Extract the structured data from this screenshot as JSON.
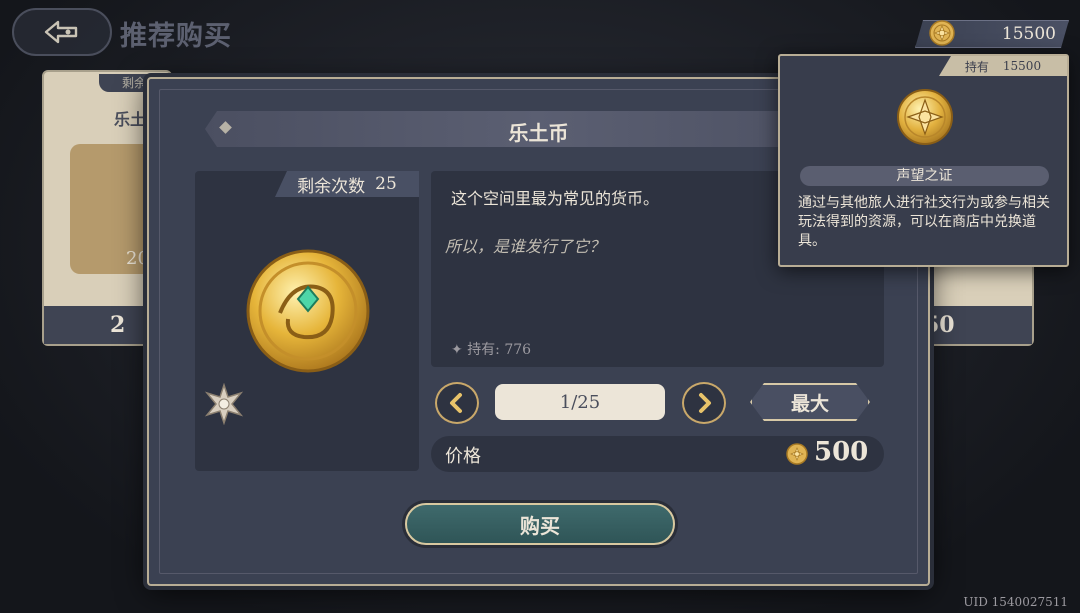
{
  "header": {
    "title": "推荐购买",
    "currency_value": "15500"
  },
  "background_cards": {
    "left_badge": "剩余",
    "left_name": "乐土",
    "left_count": "20",
    "left_price": "2",
    "right_price": "50"
  },
  "dialog": {
    "title": "乐土币",
    "remaining_label": "剩余次数",
    "remaining_value": "25",
    "description": "这个空间里最为常见的货币。",
    "flavor_text": "所以，是谁发行了它？",
    "held_label": "持有: 776",
    "quantity_value": "1/25",
    "max_label": "最大",
    "price_label": "价格",
    "price_value": "500",
    "buy_label": "购买"
  },
  "tooltip": {
    "held_label": "持有",
    "held_value": "15500",
    "item_name": "声望之证",
    "description": "通过与其他旅人进行社交行为或参与相关玩法得到的资源，可以在商店中兑换道具。"
  },
  "footer": {
    "uid": "UID 1540027511"
  },
  "colors": {
    "accent_gold": "#c9a86a",
    "dialog_bg": "#3b4152",
    "panel_bg": "#2e3341",
    "buy_button": "#3f6a6c",
    "text_light": "#ece5d8"
  }
}
